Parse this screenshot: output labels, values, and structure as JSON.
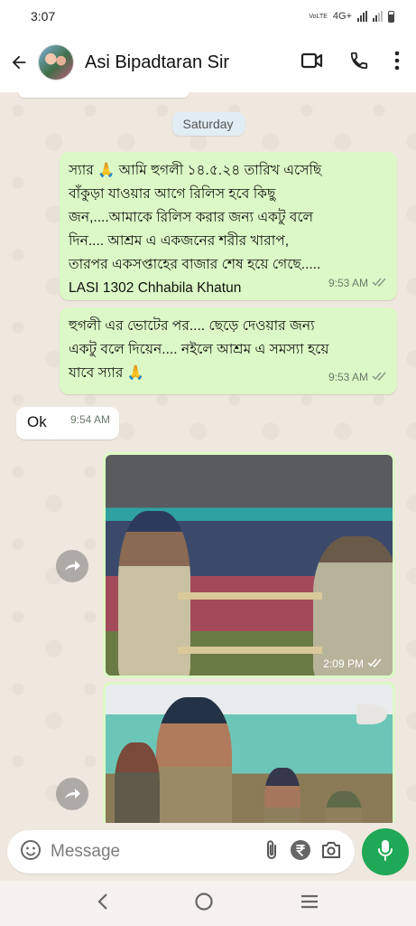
{
  "status_bar": {
    "time": "3:07",
    "network": "4G+",
    "volte": "VoLTE"
  },
  "header": {
    "contact_name": "Asi Bipadtaran Sir"
  },
  "chat": {
    "date_chip": "Saturday",
    "messages": [
      {
        "direction": "outgoing",
        "text": "স্যার 🙏 আমি হুগলী ১৪.৫.২৪ তারিখ এসেছি\nবাঁকুড়া যাওয়ার আগে রিলিস হবে কিছু\nজন,....আমাকে রিলিস করার জন্য একটু বলে\nদিন.... আশ্রম এ একজনের শরীর খারাপ,\nতারপর একসপ্তাহের বাজার শেষ হয়ে গেছে.....\nLASI 1302 Chhabila Khatun",
        "time": "9:53 AM"
      },
      {
        "direction": "outgoing",
        "text": "হুগলী এর ভোটের পর.... ছেড়ে দেওয়ার জন্য\nএকটু বলে দিয়েন.... নইলে আশ্রম এ সমস্যা হয়ে\nযাবে স্যার 🙏",
        "time": "9:53 AM"
      },
      {
        "direction": "incoming",
        "text": "Ok",
        "time": "9:54 AM"
      },
      {
        "direction": "outgoing",
        "type": "image",
        "time": "2:09 PM"
      },
      {
        "direction": "outgoing",
        "type": "image",
        "time": ""
      }
    ]
  },
  "composer": {
    "placeholder": "Message"
  },
  "colors": {
    "outgoing_bubble": "#dcf8c6",
    "incoming_bubble": "#ffffff",
    "mic_button": "#1fa855",
    "chat_bg": "#efe8de"
  },
  "icons": [
    "back-arrow-icon",
    "video-call-icon",
    "phone-icon",
    "more-vert-icon",
    "emoji-icon",
    "attach-icon",
    "rupee-icon",
    "camera-icon",
    "mic-icon",
    "forward-icon",
    "double-check-icon"
  ]
}
